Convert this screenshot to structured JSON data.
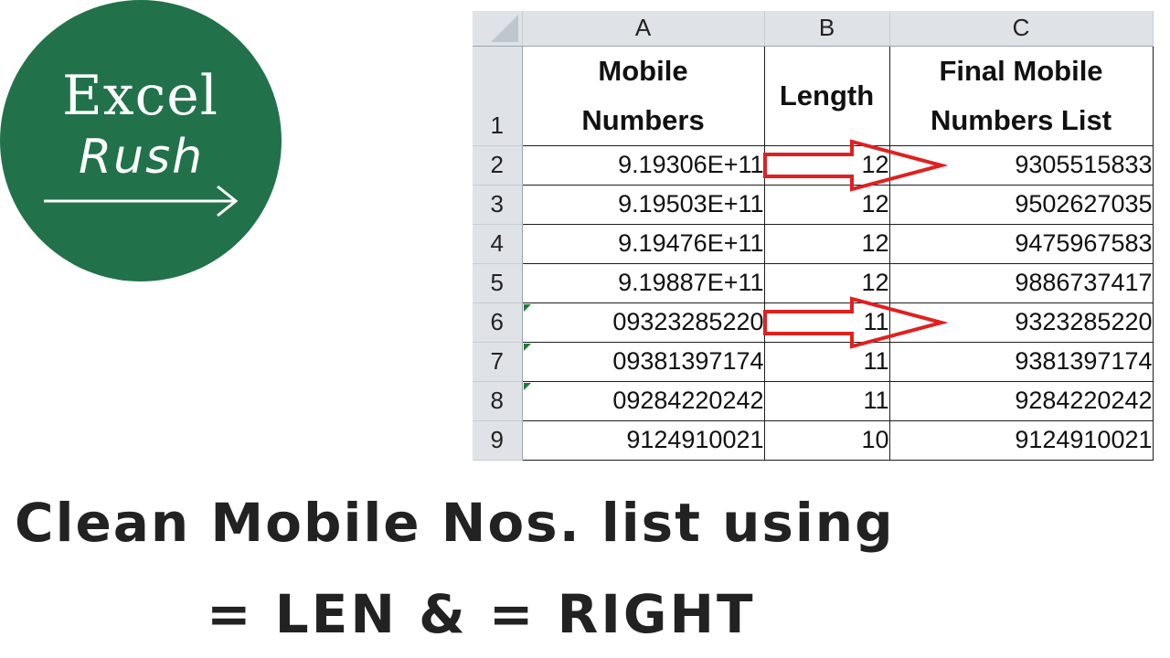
{
  "logo": {
    "line1": "Excel",
    "line2": "Rush",
    "bg_color": "#21724a",
    "icon": "arrow-right-icon"
  },
  "spreadsheet": {
    "column_headers": [
      "A",
      "B",
      "C"
    ],
    "row_headers": [
      "1",
      "2",
      "3",
      "4",
      "5",
      "6",
      "7",
      "8",
      "9"
    ],
    "header_row": {
      "a": [
        "Mobile",
        "Numbers"
      ],
      "b": "Length",
      "c": [
        "Final Mobile",
        "Numbers List"
      ]
    },
    "rows": [
      {
        "a": "9.19306E+11",
        "b": "12",
        "c": "9305515833",
        "arrow": true,
        "text_flag": false
      },
      {
        "a": "9.19503E+11",
        "b": "12",
        "c": "9502627035",
        "arrow": false,
        "text_flag": false
      },
      {
        "a": "9.19476E+11",
        "b": "12",
        "c": "9475967583",
        "arrow": false,
        "text_flag": false
      },
      {
        "a": "9.19887E+11",
        "b": "12",
        "c": "9886737417",
        "arrow": false,
        "text_flag": false
      },
      {
        "a": "09323285220",
        "b": "11",
        "c": "9323285220",
        "arrow": true,
        "text_flag": true
      },
      {
        "a": "09381397174",
        "b": "11",
        "c": "9381397174",
        "arrow": false,
        "text_flag": true
      },
      {
        "a": "09284220242",
        "b": "11",
        "c": "9284220242",
        "arrow": false,
        "text_flag": true
      },
      {
        "a": "9124910021",
        "b": "10",
        "c": "9124910021",
        "arrow": false,
        "text_flag": false
      }
    ],
    "arrow_color": "#e02020",
    "arrow_icon": "red-outline-arrow-icon"
  },
  "title": {
    "line1": "Clean Mobile Nos. list using",
    "line2": "= LEN & = RIGHT"
  }
}
